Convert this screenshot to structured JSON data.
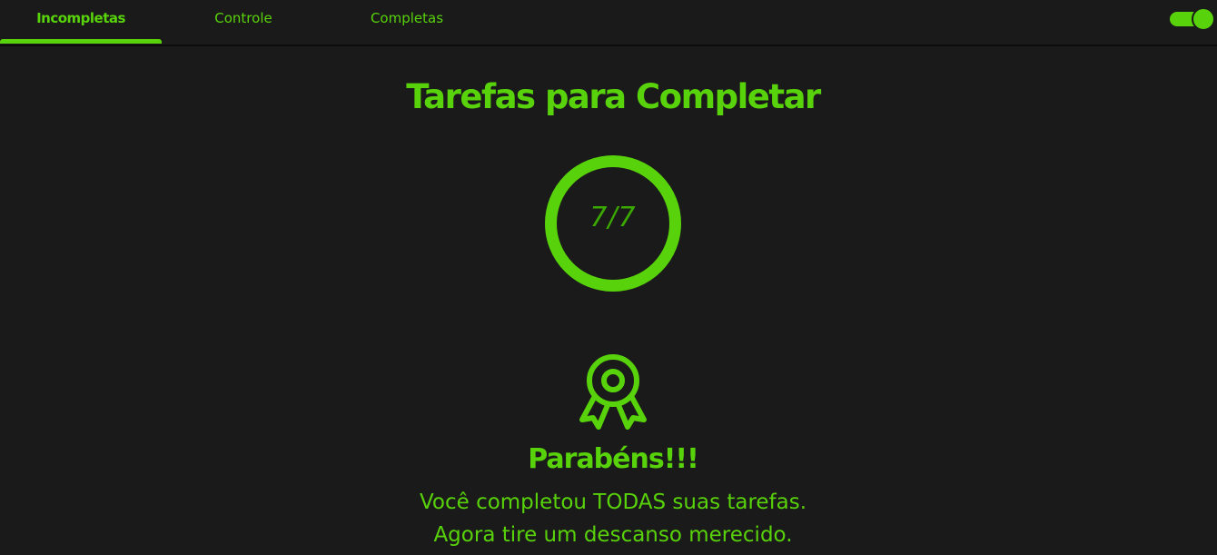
{
  "tabs": [
    {
      "label": "Incompletas",
      "active": true
    },
    {
      "label": "Controle",
      "active": false
    },
    {
      "label": "Completas",
      "active": false
    }
  ],
  "theme_toggle": {
    "on": true
  },
  "main": {
    "title": "Tarefas para Completar",
    "progress": {
      "completed": 7,
      "total": 7,
      "label": "7/7"
    },
    "award_icon": "award-ribbon-icon",
    "congrats": "Parabéns!!!",
    "message_line1": "Você completou TODAS suas tarefas.",
    "message_line2": "Agora tire um descanso merecido."
  },
  "colors": {
    "accent": "#58d20a",
    "background": "#1a1a1a",
    "progress_text": "#3aa800"
  }
}
